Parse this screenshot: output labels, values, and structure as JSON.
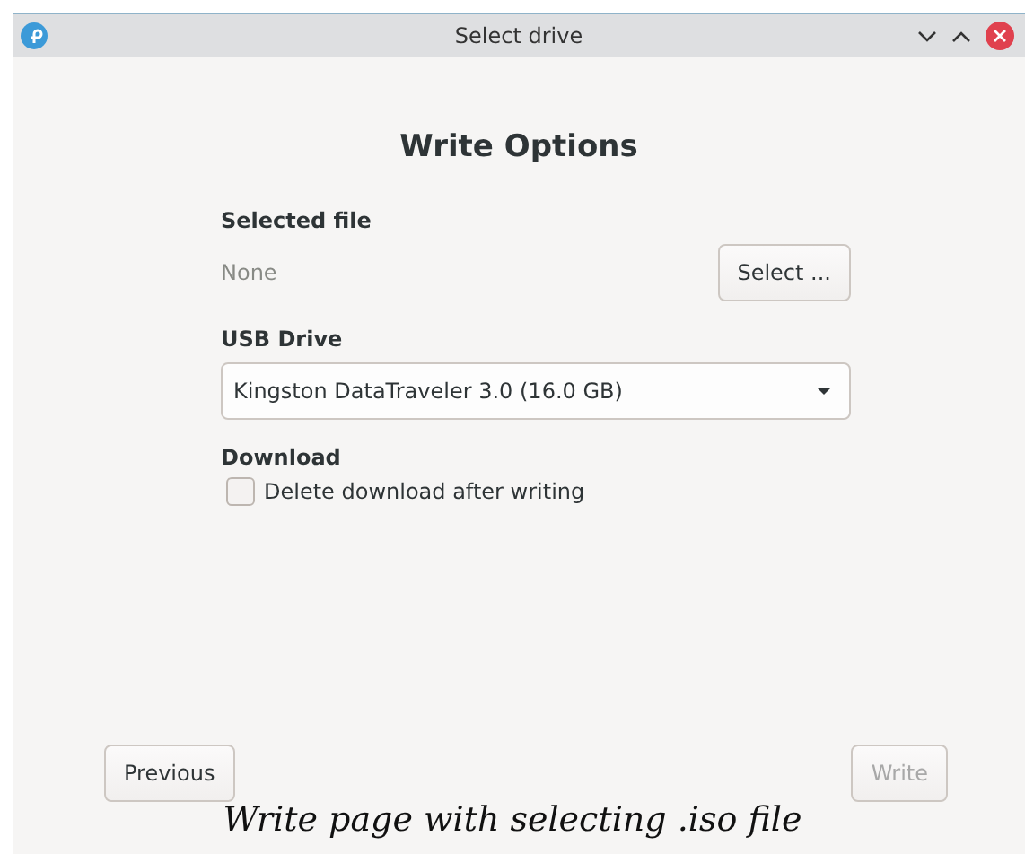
{
  "window": {
    "title": "Select drive"
  },
  "heading": "Write Options",
  "selected_file": {
    "label": "Selected file",
    "value": "None",
    "button": "Select ..."
  },
  "usb_drive": {
    "label": "USB Drive",
    "value": "Kingston DataTraveler 3.0 (16.0 GB)"
  },
  "download": {
    "label": "Download",
    "option": {
      "label": "Delete download after writing",
      "checked": false
    }
  },
  "buttons": [
    {
      "label": "Previous",
      "disabled": false
    },
    {
      "label": "Write",
      "disabled": true
    }
  ],
  "caption": "Write page with selecting .iso file"
}
